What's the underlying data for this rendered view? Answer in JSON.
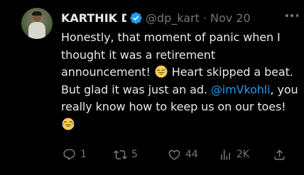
{
  "tweet": {
    "author_name": "KARTHIK D",
    "author_name_visible": "KARTHIK D",
    "handle": "@dp_kart",
    "separator": "·",
    "date": "Nov 20",
    "text": {
      "part1": "Honestly, that moment of panic when I thought it was a retirement announcement! ",
      "emoji1": "grinning-face-with-sweat",
      "part2": " Heart skipped a beat. But glad it was just an ad. ",
      "mention": "@imVkohli",
      "part3": ", you really know how to keep us on our toes! ",
      "emoji2": "face-with-tears-of-joy"
    },
    "stats": {
      "replies": "1",
      "retweets": "5",
      "likes": "44",
      "views": "2K"
    }
  },
  "colors": {
    "background": "#000000",
    "text": "#e7e9ea",
    "muted": "#71767b",
    "accent": "#1d9bf0"
  }
}
